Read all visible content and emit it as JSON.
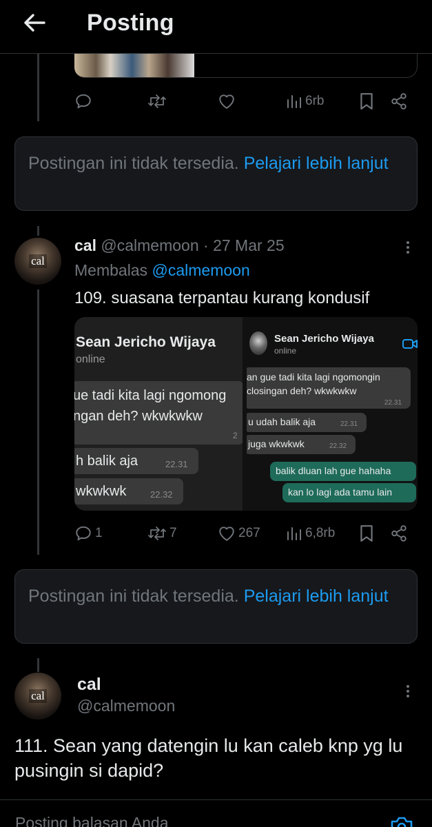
{
  "header": {
    "title": "Posting",
    "back_icon": "arrow-left-icon"
  },
  "previous_post": {
    "actions": {
      "views": "6rb"
    }
  },
  "unavailable_notice_1": {
    "text": "Postingan ini tidak tersedia.",
    "link": "Pelajari lebih lanjut"
  },
  "post_1": {
    "avatar_label": "cal",
    "name": "cal",
    "handle": "@calmemoon",
    "separator": "·",
    "date": "27 Mar 25",
    "reply_prefix": "Membalas",
    "reply_handle": "@calmemoon",
    "text": "109. suasana terpantau kurang kondusif",
    "media": {
      "left": {
        "contact_name": "Sean Jericho Wijaya",
        "status": "online",
        "messages": [
          {
            "text": "ue tadi kita lagi ngomong",
            "text2": "ngan deh? wkwkwkw",
            "time": "2"
          },
          {
            "text": "h balik aja",
            "time": "22.31"
          },
          {
            "text": "wkwkwk",
            "time": "22.32"
          }
        ]
      },
      "right": {
        "contact_name": "Sean Jericho Wijaya",
        "status": "online",
        "messages": [
          {
            "text": "an gue tadi kita lagi ngomongin",
            "text2": "closingan deh? wkwkwkw",
            "time": "22.31"
          },
          {
            "text": "u udah balik aja",
            "time": "22.31"
          },
          {
            "text": "juga wkwkwk",
            "time": "22.32"
          }
        ],
        "outgoing": [
          {
            "text": "balik dluan lah gue hahaha"
          },
          {
            "text": "kan lo lagi ada tamu lain"
          }
        ]
      }
    },
    "actions": {
      "replies": "1",
      "reposts": "7",
      "likes": "267",
      "views": "6,8rb"
    }
  },
  "unavailable_notice_2": {
    "text": "Postingan ini tidak tersedia.",
    "link": "Pelajari lebih lanjut"
  },
  "post_2": {
    "avatar_label": "cal",
    "name": "cal",
    "handle": "@calmemoon",
    "text": "111. Sean yang datengin lu kan caleb knp yg lu pusingin si dapid?"
  },
  "reply_bar": {
    "placeholder": "Posting balasan Anda"
  },
  "colors": {
    "background": "#000000",
    "link": "#1d9bf0",
    "muted": "#71767b",
    "card": "#16181c",
    "border": "#2f3336"
  }
}
